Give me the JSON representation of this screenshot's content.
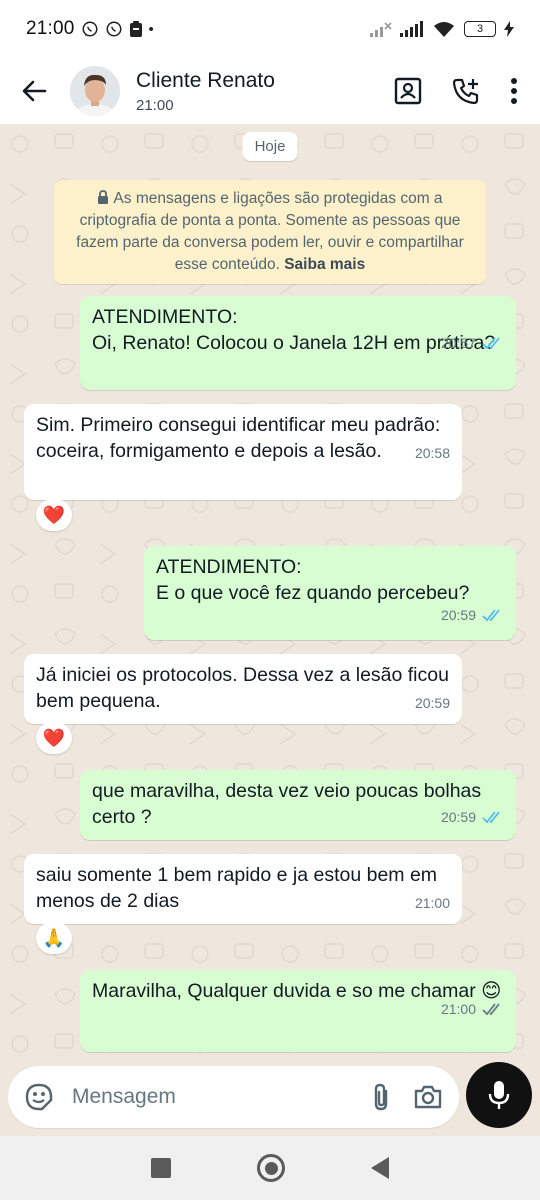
{
  "status_bar": {
    "time": "21:00",
    "battery": "3"
  },
  "header": {
    "contact_name": "Cliente Renato",
    "contact_status": "21:00"
  },
  "chat": {
    "date_chip": "Hoje",
    "encryption_notice": "As mensagens e ligações são protegidas com a criptografia de ponta a ponta. Somente as pessoas que fazem parte da conversa podem ler, ouvir e compartilhar esse conteúdo.",
    "encryption_link": "Saiba mais",
    "messages": [
      {
        "direction": "out",
        "text": "ATENDIMENTO:\nOi, Renato! Colocou o Janela 12H em prática?",
        "time": "20:57",
        "status": "read"
      },
      {
        "direction": "in",
        "text": "Sim. Primeiro consegui identificar meu padrão: coceira, formigamento e depois a lesão.",
        "time": "20:58",
        "reaction": "❤️"
      },
      {
        "direction": "out",
        "text": "ATENDIMENTO:\nE o que você fez quando percebeu?",
        "time": "20:59",
        "status": "read"
      },
      {
        "direction": "in",
        "text": "Já iniciei os protocolos. Dessa vez a lesão ficou bem pequena.",
        "time": "20:59",
        "reaction": "❤️"
      },
      {
        "direction": "out",
        "text": "que maravilha, desta vez veio poucas bolhas certo ?",
        "time": "20:59",
        "status": "read"
      },
      {
        "direction": "in",
        "text": "saiu somente 1 bem rapido e ja estou bem em menos de 2 dias",
        "time": "21:00",
        "reaction": "🙏"
      },
      {
        "direction": "out",
        "text": "Maravilha, Qualquer duvida e so me chamar 😊",
        "time": "21:00",
        "status": "delivered"
      }
    ]
  },
  "input": {
    "placeholder": "Mensagem"
  },
  "colors": {
    "outgoing_bubble": "#d9fdd3",
    "incoming_bubble": "#ffffff",
    "read_ticks": "#53bdeb",
    "delivered_ticks": "#667781",
    "chat_background": "#efe7dd"
  }
}
